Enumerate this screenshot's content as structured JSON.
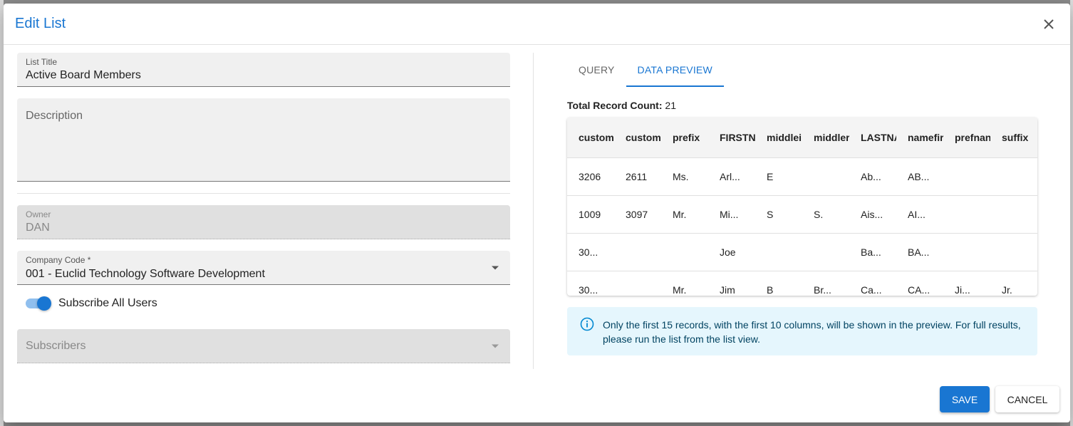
{
  "dialog": {
    "title": "Edit List",
    "close_icon": "close-icon"
  },
  "form": {
    "list_title": {
      "label": "List Title",
      "value": "Active Board Members"
    },
    "description": {
      "placeholder": "Description",
      "value": ""
    },
    "owner": {
      "label": "Owner",
      "value": "DAN"
    },
    "company_code": {
      "label": "Company Code *",
      "value": "001 - Euclid Technology Software Development"
    },
    "subscribe_all": {
      "label": "Subscribe All Users",
      "checked": true
    },
    "subscribers": {
      "placeholder": "Subscribers"
    }
  },
  "tabs": [
    {
      "label": "QUERY",
      "active": false
    },
    {
      "label": "DATA PREVIEW",
      "active": true
    }
  ],
  "preview": {
    "count_label": "Total Record Count:",
    "count_value": "21",
    "columns": [
      "custom",
      "custom",
      "prefix",
      "FIRSTN",
      "middlei",
      "middler",
      "LASTNA",
      "namefir",
      "prefnan",
      "suffix"
    ],
    "rows": [
      [
        "3206",
        "2611",
        "Ms.",
        "Arl...",
        "E",
        "",
        "Ab...",
        "AB...",
        "",
        ""
      ],
      [
        "1009",
        "3097",
        "Mr.",
        "Mi...",
        "S",
        "S.",
        "Ais...",
        "AI...",
        "",
        ""
      ],
      [
        "30...",
        "",
        "",
        "Joe",
        "",
        "",
        "Ba...",
        "BA...",
        "",
        ""
      ],
      [
        "30...",
        "",
        "Mr.",
        "Jim",
        "B",
        "Br...",
        "Ca...",
        "CA...",
        "Ji...",
        "Jr."
      ]
    ],
    "info_text": "Only the first 15 records, with the first 10 columns, will be shown in the preview. For full results, please run the list from the list view."
  },
  "actions": {
    "save": "SAVE",
    "cancel": "CANCEL"
  },
  "colors": {
    "accent": "#1976d2",
    "info_bg": "#e5f6fd",
    "info_text": "#014361"
  }
}
